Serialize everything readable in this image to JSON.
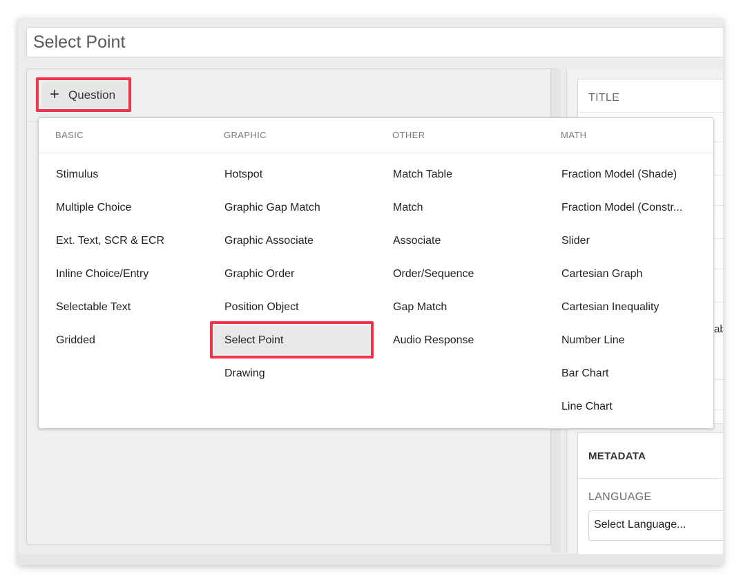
{
  "page": {
    "title_value": "Select Point"
  },
  "toolbar": {
    "add_question_icon": "+",
    "add_question_label": "Question"
  },
  "right_panel": {
    "title_label": "TITLE",
    "peek_text": "ab",
    "metadata_title": "METADATA",
    "language_label": "LANGUAGE",
    "language_select_value": "Select Language..."
  },
  "menu": {
    "columns": [
      {
        "heading": "BASIC",
        "items": [
          "Stimulus",
          "Multiple Choice",
          "Ext. Text, SCR & ECR",
          "Inline Choice/Entry",
          "Selectable Text",
          "Gridded"
        ]
      },
      {
        "heading": "GRAPHIC",
        "items": [
          "Hotspot",
          "Graphic Gap Match",
          "Graphic Associate",
          "Graphic Order",
          "Position Object",
          "Select Point",
          "Drawing"
        ]
      },
      {
        "heading": "OTHER",
        "items": [
          "Match Table",
          "Match",
          "Associate",
          "Order/Sequence",
          "Gap Match",
          "Audio Response"
        ]
      },
      {
        "heading": "MATH",
        "items": [
          "Fraction Model (Shade)",
          "Fraction Model (Constr...",
          "Slider",
          "Cartesian Graph",
          "Cartesian Inequality",
          "Number Line",
          "Bar Chart",
          "Line Chart"
        ]
      }
    ],
    "selected_item": "Select Point"
  },
  "colors": {
    "highlight": "#f1334b",
    "selected_bg": "#e8e8e8"
  }
}
